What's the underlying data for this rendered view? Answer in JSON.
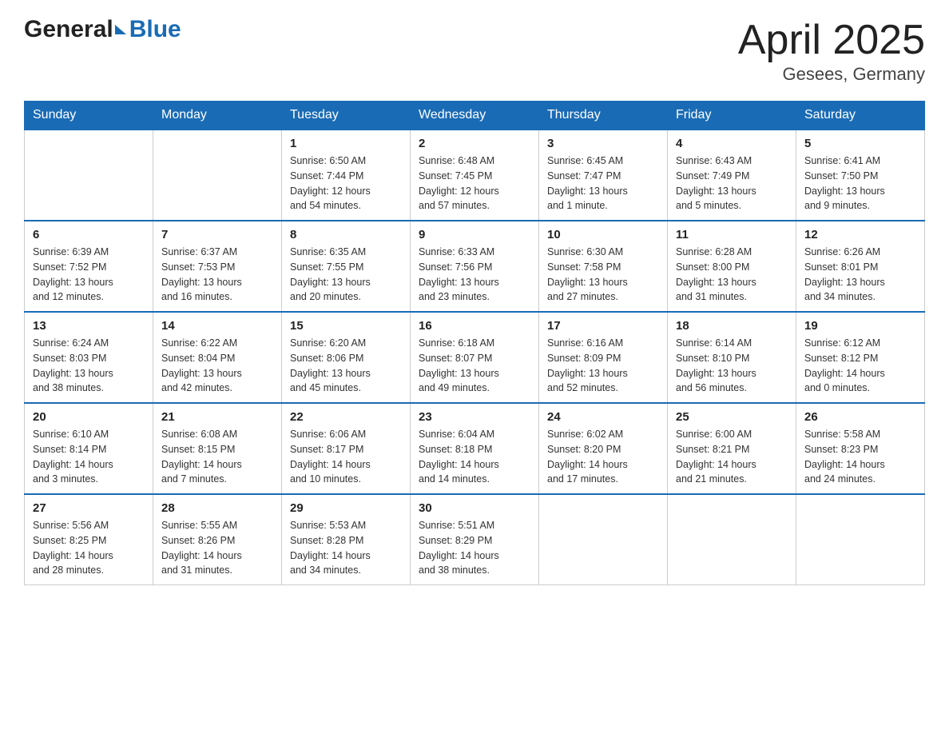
{
  "header": {
    "logo_general": "General",
    "logo_blue": "Blue",
    "title": "April 2025",
    "subtitle": "Gesees, Germany"
  },
  "calendar": {
    "days": [
      "Sunday",
      "Monday",
      "Tuesday",
      "Wednesday",
      "Thursday",
      "Friday",
      "Saturday"
    ],
    "weeks": [
      [
        {
          "day": "",
          "info": ""
        },
        {
          "day": "",
          "info": ""
        },
        {
          "day": "1",
          "info": "Sunrise: 6:50 AM\nSunset: 7:44 PM\nDaylight: 12 hours\nand 54 minutes."
        },
        {
          "day": "2",
          "info": "Sunrise: 6:48 AM\nSunset: 7:45 PM\nDaylight: 12 hours\nand 57 minutes."
        },
        {
          "day": "3",
          "info": "Sunrise: 6:45 AM\nSunset: 7:47 PM\nDaylight: 13 hours\nand 1 minute."
        },
        {
          "day": "4",
          "info": "Sunrise: 6:43 AM\nSunset: 7:49 PM\nDaylight: 13 hours\nand 5 minutes."
        },
        {
          "day": "5",
          "info": "Sunrise: 6:41 AM\nSunset: 7:50 PM\nDaylight: 13 hours\nand 9 minutes."
        }
      ],
      [
        {
          "day": "6",
          "info": "Sunrise: 6:39 AM\nSunset: 7:52 PM\nDaylight: 13 hours\nand 12 minutes."
        },
        {
          "day": "7",
          "info": "Sunrise: 6:37 AM\nSunset: 7:53 PM\nDaylight: 13 hours\nand 16 minutes."
        },
        {
          "day": "8",
          "info": "Sunrise: 6:35 AM\nSunset: 7:55 PM\nDaylight: 13 hours\nand 20 minutes."
        },
        {
          "day": "9",
          "info": "Sunrise: 6:33 AM\nSunset: 7:56 PM\nDaylight: 13 hours\nand 23 minutes."
        },
        {
          "day": "10",
          "info": "Sunrise: 6:30 AM\nSunset: 7:58 PM\nDaylight: 13 hours\nand 27 minutes."
        },
        {
          "day": "11",
          "info": "Sunrise: 6:28 AM\nSunset: 8:00 PM\nDaylight: 13 hours\nand 31 minutes."
        },
        {
          "day": "12",
          "info": "Sunrise: 6:26 AM\nSunset: 8:01 PM\nDaylight: 13 hours\nand 34 minutes."
        }
      ],
      [
        {
          "day": "13",
          "info": "Sunrise: 6:24 AM\nSunset: 8:03 PM\nDaylight: 13 hours\nand 38 minutes."
        },
        {
          "day": "14",
          "info": "Sunrise: 6:22 AM\nSunset: 8:04 PM\nDaylight: 13 hours\nand 42 minutes."
        },
        {
          "day": "15",
          "info": "Sunrise: 6:20 AM\nSunset: 8:06 PM\nDaylight: 13 hours\nand 45 minutes."
        },
        {
          "day": "16",
          "info": "Sunrise: 6:18 AM\nSunset: 8:07 PM\nDaylight: 13 hours\nand 49 minutes."
        },
        {
          "day": "17",
          "info": "Sunrise: 6:16 AM\nSunset: 8:09 PM\nDaylight: 13 hours\nand 52 minutes."
        },
        {
          "day": "18",
          "info": "Sunrise: 6:14 AM\nSunset: 8:10 PM\nDaylight: 13 hours\nand 56 minutes."
        },
        {
          "day": "19",
          "info": "Sunrise: 6:12 AM\nSunset: 8:12 PM\nDaylight: 14 hours\nand 0 minutes."
        }
      ],
      [
        {
          "day": "20",
          "info": "Sunrise: 6:10 AM\nSunset: 8:14 PM\nDaylight: 14 hours\nand 3 minutes."
        },
        {
          "day": "21",
          "info": "Sunrise: 6:08 AM\nSunset: 8:15 PM\nDaylight: 14 hours\nand 7 minutes."
        },
        {
          "day": "22",
          "info": "Sunrise: 6:06 AM\nSunset: 8:17 PM\nDaylight: 14 hours\nand 10 minutes."
        },
        {
          "day": "23",
          "info": "Sunrise: 6:04 AM\nSunset: 8:18 PM\nDaylight: 14 hours\nand 14 minutes."
        },
        {
          "day": "24",
          "info": "Sunrise: 6:02 AM\nSunset: 8:20 PM\nDaylight: 14 hours\nand 17 minutes."
        },
        {
          "day": "25",
          "info": "Sunrise: 6:00 AM\nSunset: 8:21 PM\nDaylight: 14 hours\nand 21 minutes."
        },
        {
          "day": "26",
          "info": "Sunrise: 5:58 AM\nSunset: 8:23 PM\nDaylight: 14 hours\nand 24 minutes."
        }
      ],
      [
        {
          "day": "27",
          "info": "Sunrise: 5:56 AM\nSunset: 8:25 PM\nDaylight: 14 hours\nand 28 minutes."
        },
        {
          "day": "28",
          "info": "Sunrise: 5:55 AM\nSunset: 8:26 PM\nDaylight: 14 hours\nand 31 minutes."
        },
        {
          "day": "29",
          "info": "Sunrise: 5:53 AM\nSunset: 8:28 PM\nDaylight: 14 hours\nand 34 minutes."
        },
        {
          "day": "30",
          "info": "Sunrise: 5:51 AM\nSunset: 8:29 PM\nDaylight: 14 hours\nand 38 minutes."
        },
        {
          "day": "",
          "info": ""
        },
        {
          "day": "",
          "info": ""
        },
        {
          "day": "",
          "info": ""
        }
      ]
    ]
  }
}
